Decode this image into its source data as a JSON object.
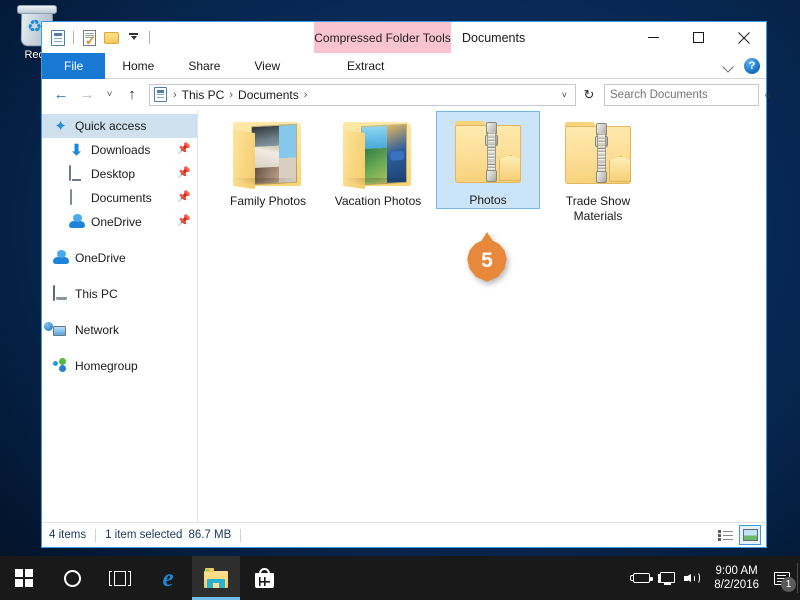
{
  "desktop": {
    "icons": [
      {
        "name": "Recycle Bin",
        "label_visible": "Recy"
      }
    ]
  },
  "window": {
    "title": "Documents",
    "quick_access_toolbar": [
      {
        "icon": "properties-icon"
      },
      {
        "icon": "new-item-icon"
      },
      {
        "icon": "folder-icon"
      },
      {
        "icon": "customize-chevron-icon"
      }
    ],
    "contextual_tab_header": "Compressed Folder Tools",
    "tabs": [
      {
        "label": "File",
        "state": "active-file"
      },
      {
        "label": "Home",
        "state": "normal"
      },
      {
        "label": "Share",
        "state": "normal"
      },
      {
        "label": "View",
        "state": "normal"
      },
      {
        "label": "Extract",
        "state": "contextual"
      }
    ],
    "controls": {
      "minimize": "—",
      "maximize": "□",
      "close": "✕",
      "collapse_ribbon": "chevron-down-icon",
      "help": "?"
    },
    "address": {
      "back": "←",
      "forward": "→",
      "recent": "˅",
      "up": "↑",
      "breadcrumbs": [
        "This PC",
        "Documents"
      ],
      "separator": "›",
      "dropdown": "˅",
      "refresh": "↻"
    },
    "search": {
      "placeholder": "Search Documents",
      "value": "",
      "icon": "search-icon"
    },
    "navigation_pane": [
      {
        "label": "Quick access",
        "icon": "star-pin-icon",
        "indent": false,
        "selected": true,
        "pinned": false
      },
      {
        "label": "Downloads",
        "icon": "download-icon",
        "indent": true,
        "selected": false,
        "pinned": true
      },
      {
        "label": "Desktop",
        "icon": "monitor-icon",
        "indent": true,
        "selected": false,
        "pinned": true
      },
      {
        "label": "Documents",
        "icon": "document-icon",
        "indent": true,
        "selected": false,
        "pinned": true
      },
      {
        "label": "OneDrive",
        "icon": "cloud-icon",
        "indent": true,
        "selected": false,
        "pinned": true
      },
      {
        "label": "OneDrive",
        "icon": "cloud-icon",
        "indent": false,
        "selected": false,
        "pinned": false
      },
      {
        "label": "This PC",
        "icon": "pc-icon",
        "indent": false,
        "selected": false,
        "pinned": false
      },
      {
        "label": "Network",
        "icon": "network-icon",
        "indent": false,
        "selected": false,
        "pinned": false
      },
      {
        "label": "Homegroup",
        "icon": "homegroup-icon",
        "indent": false,
        "selected": false,
        "pinned": false
      }
    ],
    "items": [
      {
        "name": "Family Photos",
        "type": "photo-folder",
        "selected": false
      },
      {
        "name": "Vacation Photos",
        "type": "photo-folder",
        "selected": false
      },
      {
        "name": "Photos",
        "type": "zipped-folder",
        "selected": true
      },
      {
        "name": "Trade Show Materials",
        "type": "zipped-folder",
        "selected": false
      }
    ],
    "callout": {
      "number": "5",
      "color": "#e8883a"
    },
    "status_bar": {
      "item_count": "4 items",
      "selection": "1 item selected",
      "size": "86.7 MB",
      "views": [
        {
          "name": "details-view",
          "active": false
        },
        {
          "name": "large-icons-view",
          "active": true
        }
      ]
    }
  },
  "taskbar": {
    "buttons": [
      {
        "name": "start-button",
        "icon": "windows-logo-icon",
        "active": false
      },
      {
        "name": "cortana-button",
        "icon": "circle-icon",
        "active": false
      },
      {
        "name": "task-view-button",
        "icon": "task-view-icon",
        "active": false
      },
      {
        "name": "edge-button",
        "icon": "edge-icon",
        "active": false
      },
      {
        "name": "file-explorer-button",
        "icon": "folder-icon",
        "active": true
      },
      {
        "name": "store-button",
        "icon": "store-bag-icon",
        "active": false
      }
    ],
    "tray": [
      {
        "name": "battery-icon"
      },
      {
        "name": "network-icon"
      },
      {
        "name": "volume-icon"
      }
    ],
    "clock": {
      "time": "9:00 AM",
      "date": "8/2/2016"
    },
    "notifications": {
      "icon": "action-center-icon",
      "badge": "1"
    }
  },
  "colors": {
    "accent": "#1879d4",
    "contextual_tab": "#f9c3d0",
    "selection": "#cbe4f7",
    "callout": "#e8883a",
    "desktop": "#0a2a5a"
  }
}
